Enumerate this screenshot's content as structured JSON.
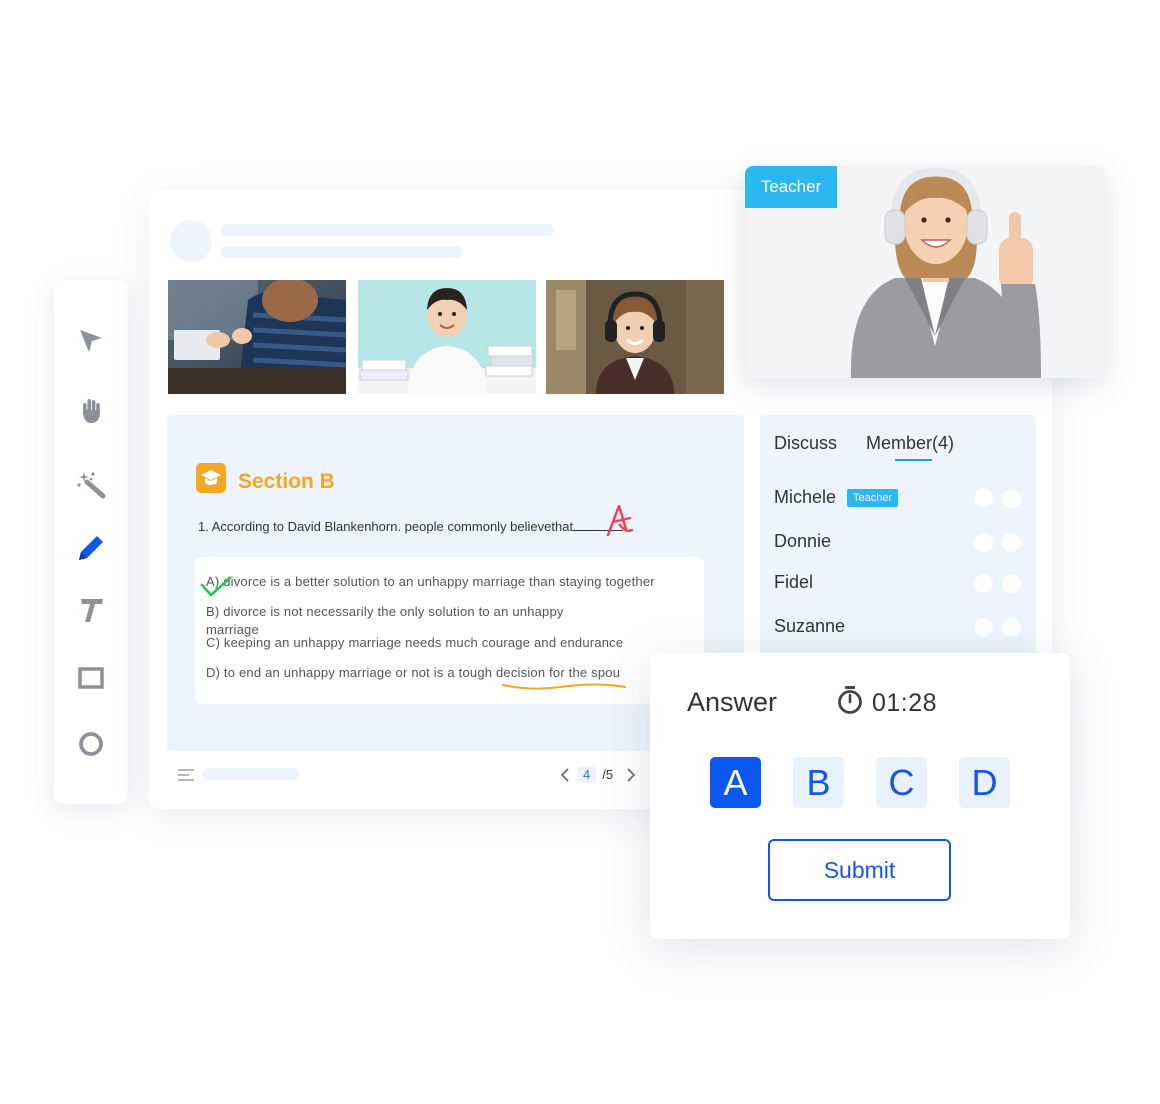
{
  "toolbar": {
    "tools": [
      {
        "icon": "pointer-icon"
      },
      {
        "icon": "hand-icon"
      },
      {
        "icon": "magic-wand-icon"
      },
      {
        "icon": "pen-icon"
      },
      {
        "icon": "text-icon"
      },
      {
        "icon": "rectangle-icon"
      },
      {
        "icon": "circle-icon"
      }
    ]
  },
  "lesson": {
    "section_title": "Section B",
    "question": "1. According to David Blankenhorn. people commonly believethat",
    "question_end": ".",
    "handwritten_answer": "A",
    "options": [
      "A) divorce is a better solution to an unhappy marriage than staying together",
      "B) divorce is not necessarily the only solution to an unhappy marriage",
      "C) keeping an unhappy marriage needs much courage and endurance",
      "D) to end an unhappy marriage or not is a tough decision for the spou"
    ],
    "page_current": "4",
    "page_total": "/5"
  },
  "members": {
    "tabs": [
      "Discuss",
      "Member(4)"
    ],
    "list": [
      {
        "name": "Michele",
        "badge": "Teacher"
      },
      {
        "name": "Donnie"
      },
      {
        "name": "Fidel"
      },
      {
        "name": "Suzanne"
      }
    ]
  },
  "video": {
    "label": "Teacher"
  },
  "answer": {
    "title": "Answer",
    "timer": "01:28",
    "choices": [
      "A",
      "B",
      "C",
      "D"
    ],
    "selected": "A",
    "submit_label": "Submit"
  },
  "colors": {
    "accent_blue": "#0a58ef",
    "section_orange": "#f5a623",
    "badge_cyan": "#2bb8f0",
    "panel_bg": "#edf4fd"
  }
}
